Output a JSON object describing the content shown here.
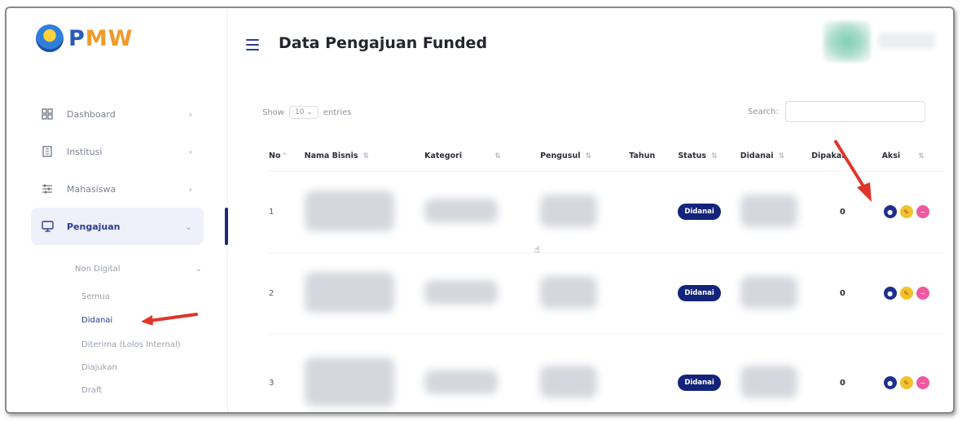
{
  "brand": {
    "logo_text_a": "P",
    "logo_text_b": "MW",
    "tagline": ""
  },
  "header": {
    "title": "Data Pengajuan Funded"
  },
  "sidebar": {
    "items": [
      {
        "label": "Dashboard",
        "icon": "grid-icon",
        "active": false
      },
      {
        "label": "Institusi",
        "icon": "building-icon",
        "active": false
      },
      {
        "label": "Mahasiswa",
        "icon": "sliders-icon",
        "active": false
      },
      {
        "label": "Pengajuan",
        "icon": "monitor-icon",
        "active": true
      }
    ],
    "submenu_heading": "Non Digital",
    "submenu": [
      {
        "label": "Semua",
        "active": false
      },
      {
        "label": "Didanai",
        "active": true
      },
      {
        "label": "Diterima (Lolos Internal)",
        "active": false
      },
      {
        "label": "Diajukan",
        "active": false
      },
      {
        "label": "Draft",
        "active": false
      }
    ]
  },
  "table_controls": {
    "show_label": "Show",
    "entries_value": "10",
    "entries_label": "entries",
    "search_label": "Search:"
  },
  "table": {
    "columns": [
      "No",
      "Nama Bisnis",
      "Kategori",
      "Pengusul",
      "Tahun",
      "Status",
      "Didanai",
      "Dipakai",
      "Aksi"
    ],
    "rows": [
      {
        "no": "1",
        "status": "Didanai",
        "dipakai": "0"
      },
      {
        "no": "2",
        "status": "Didanai",
        "dipakai": "0"
      },
      {
        "no": "3",
        "status": "Didanai",
        "dipakai": "0"
      }
    ]
  },
  "colors": {
    "primary": "#13247a",
    "accent_orange": "#f19a2a",
    "edit_yellow": "#f2c12e",
    "delete_pink": "#ee5aa1",
    "annotation_red": "#e0352b"
  }
}
